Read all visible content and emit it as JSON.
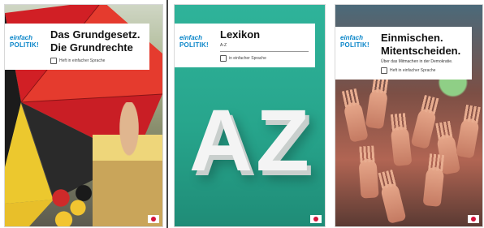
{
  "covers": [
    {
      "brand_line1": "einfach",
      "brand_line2": "POLITIK!",
      "title_line1": "Das Grundgesetz.",
      "title_line2": "Die Grundrechte",
      "note": "Heft in einfacher Sprache"
    },
    {
      "brand_line1": "einfach",
      "brand_line2": "POLITIK!",
      "title_line1": "Lexikon",
      "subtitle": "A-Z",
      "note": "in einfacher Sprache",
      "letters": [
        "A",
        "Z"
      ]
    },
    {
      "brand_line1": "einfach",
      "brand_line2": "POLITIK!",
      "title_line1": "Einmischen.",
      "title_line2": "Mitentscheiden.",
      "subtitle": "Über das Mitmachen in der Demokratie.",
      "note": "Heft in einfacher Sprache"
    }
  ],
  "colors": {
    "brand": "#0b86c9",
    "lexikon_green": "#27a58c",
    "publisher_red": "#d4143c"
  }
}
